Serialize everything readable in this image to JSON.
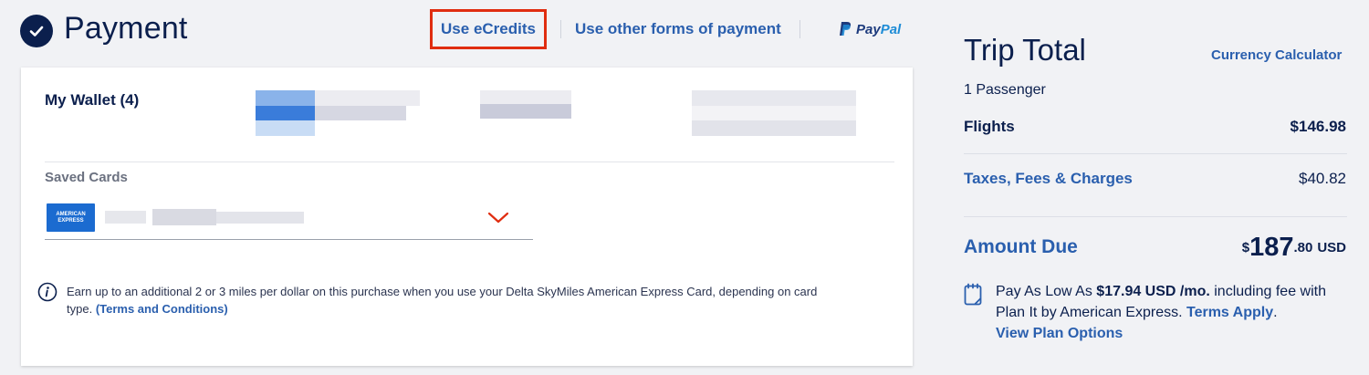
{
  "header": {
    "title": "Payment",
    "tabs": [
      {
        "label": "Use eCredits",
        "highlighted": true
      },
      {
        "label": "Use other forms of payment",
        "highlighted": false
      }
    ],
    "paypal": {
      "pay": "Pay",
      "pal": "Pal"
    }
  },
  "payment_card": {
    "wallet_label": "My Wallet (4)",
    "saved_cards_label": "Saved Cards",
    "selected_card_brand": "AMERICAN EXPRESS",
    "info_text": "Earn up to an additional 2 or 3 miles per dollar on this purchase when you use your Delta SkyMiles American Express Card, depending on card type.",
    "info_link": "(Terms and Conditions)"
  },
  "trip_total": {
    "title": "Trip Total",
    "currency_link": "Currency Calculator",
    "passengers": "1 Passenger",
    "flights_label": "Flights",
    "flights_value": "$146.98",
    "taxes_label": "Taxes, Fees & Charges",
    "taxes_value": "$40.82",
    "amount_label": "Amount Due",
    "amount_symbol": "$",
    "amount_whole": "187",
    "amount_cents": ".80",
    "amount_currency": "USD"
  },
  "plan_it": {
    "prefix": "Pay As Low As",
    "amount": "$17.94 USD /mo.",
    "mid": "including fee with Plan It by American Express.",
    "terms_link": "Terms Apply",
    "suffix": ".",
    "view_link": "View Plan Options"
  },
  "colors": {
    "navy": "#0b1f4d",
    "link_blue": "#2a5fae",
    "highlight_red": "#e02d10",
    "amex_blue": "#1b6bd0"
  },
  "icons": [
    "check-circle-icon",
    "paypal-logo-icon",
    "chevron-down-icon",
    "info-icon",
    "calendar-icon"
  ]
}
